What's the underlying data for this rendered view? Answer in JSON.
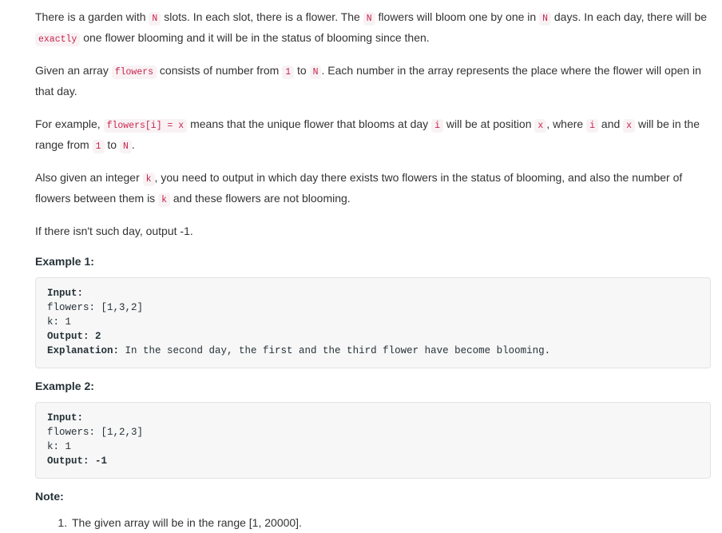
{
  "paragraphs": [
    {
      "id": "p1",
      "parts": [
        {
          "t": "text",
          "v": "There is a garden with "
        },
        {
          "t": "code",
          "v": "N"
        },
        {
          "t": "text",
          "v": " slots. In each slot, there is a flower. The "
        },
        {
          "t": "code",
          "v": "N"
        },
        {
          "t": "text",
          "v": " flowers will bloom one by one in "
        },
        {
          "t": "code",
          "v": "N"
        },
        {
          "t": "text",
          "v": " days. In each day, there will be "
        },
        {
          "t": "code",
          "v": "exactly"
        },
        {
          "t": "text",
          "v": " one flower blooming and it will be in the status of blooming since then."
        }
      ]
    },
    {
      "id": "p2",
      "parts": [
        {
          "t": "text",
          "v": "Given an array "
        },
        {
          "t": "code",
          "v": "flowers"
        },
        {
          "t": "text",
          "v": " consists of number from "
        },
        {
          "t": "code",
          "v": "1"
        },
        {
          "t": "text",
          "v": " to "
        },
        {
          "t": "code",
          "v": "N"
        },
        {
          "t": "text",
          "v": ". Each number in the array represents the place where the flower will open in that day."
        }
      ]
    },
    {
      "id": "p3",
      "parts": [
        {
          "t": "text",
          "v": "For example, "
        },
        {
          "t": "code",
          "v": "flowers[i] = x"
        },
        {
          "t": "text",
          "v": " means that the unique flower that blooms at day "
        },
        {
          "t": "code",
          "v": "i"
        },
        {
          "t": "text",
          "v": " will be at position "
        },
        {
          "t": "code",
          "v": "x"
        },
        {
          "t": "text",
          "v": ", where "
        },
        {
          "t": "code",
          "v": "i"
        },
        {
          "t": "text",
          "v": " and "
        },
        {
          "t": "code",
          "v": "x"
        },
        {
          "t": "text",
          "v": " will be in the range from "
        },
        {
          "t": "code",
          "v": "1"
        },
        {
          "t": "text",
          "v": " to "
        },
        {
          "t": "code",
          "v": "N"
        },
        {
          "t": "text",
          "v": "."
        }
      ]
    },
    {
      "id": "p4",
      "parts": [
        {
          "t": "text",
          "v": "Also given an integer "
        },
        {
          "t": "code",
          "v": "k"
        },
        {
          "t": "text",
          "v": ", you need to output in which day there exists two flowers in the status of blooming, and also the number of flowers between them is "
        },
        {
          "t": "code",
          "v": "k"
        },
        {
          "t": "text",
          "v": " and these flowers are not blooming."
        }
      ]
    },
    {
      "id": "p5",
      "parts": [
        {
          "t": "text",
          "v": "If there isn't such day, output -1."
        }
      ]
    }
  ],
  "examples": [
    {
      "heading": "Example 1:",
      "lines": [
        {
          "label": "Input:",
          "value": "",
          "bold_all": true
        },
        {
          "label": "",
          "value": "flowers: [1,3,2]",
          "bold_all": false
        },
        {
          "label": "",
          "value": "k: 1",
          "bold_all": false
        },
        {
          "label": "Output:",
          "value": " 2",
          "bold_all": true
        },
        {
          "label": "Explanation:",
          "value": " In the second day, the first and the third flower have become blooming.",
          "bold_all": false
        }
      ]
    },
    {
      "heading": "Example 2:",
      "lines": [
        {
          "label": "Input:",
          "value": "",
          "bold_all": true
        },
        {
          "label": "",
          "value": "flowers: [1,2,3]",
          "bold_all": false
        },
        {
          "label": "",
          "value": "k: 1",
          "bold_all": false
        },
        {
          "label": "Output:",
          "value": " -1",
          "bold_all": true
        }
      ]
    }
  ],
  "note": {
    "heading": "Note:",
    "items": [
      "The given array will be in the range [1, 20000]."
    ]
  },
  "colors": {
    "inline_code_text": "#c7254e",
    "inline_code_bg": "#f9f2f4",
    "code_block_bg": "#f7f7f7",
    "code_block_border": "#e3e3e3",
    "body_text": "#333333",
    "heading_text": "#263238"
  }
}
